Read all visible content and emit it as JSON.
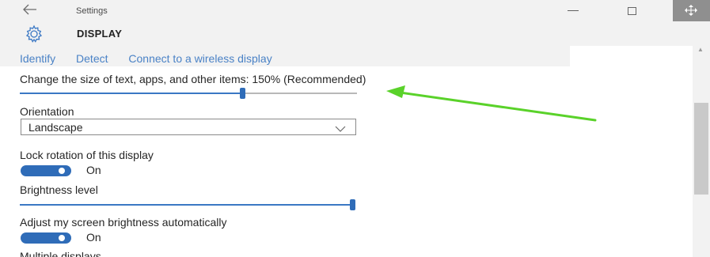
{
  "window": {
    "title": "Settings",
    "back_icon": "back-arrow-icon",
    "minimize_label": "—"
  },
  "header": {
    "heading": "DISPLAY",
    "icon": "gear-icon"
  },
  "links": [
    "Identify",
    "Detect",
    "Connect to a wireless display"
  ],
  "scale": {
    "label": "Change the size of text, apps, and other items: 150% (Recommended)",
    "value_fraction": 0.66
  },
  "orientation": {
    "label": "Orientation",
    "selected": "Landscape"
  },
  "lock_rotation": {
    "label": "Lock rotation of this display",
    "state": "On"
  },
  "brightness": {
    "label": "Brightness level",
    "value_fraction": 0.99
  },
  "auto_brightness": {
    "label": "Adjust my screen brightness automatically",
    "state": "On"
  },
  "next_section": {
    "label": "Multiple displays"
  },
  "colors": {
    "accent": "#2f6cb8",
    "link": "#4a82c6",
    "annotation": "#5ad22a"
  }
}
